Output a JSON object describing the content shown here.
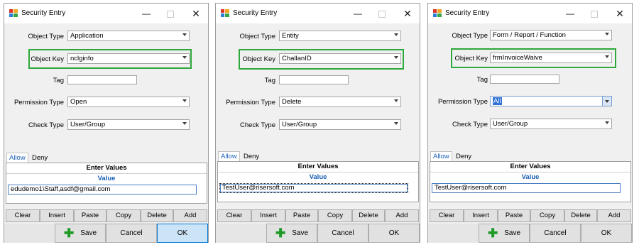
{
  "windows": [
    {
      "title": "Security Entry",
      "object_type_label": "Object Type",
      "object_type": "Application",
      "object_key_label": "Object Key",
      "object_key": "nclginfo",
      "tag_label": "Tag",
      "tag": "",
      "permission_type_label": "Permission Type",
      "permission_type": "Open",
      "check_type_label": "Check Type",
      "check_type": "User/Group",
      "tabs": [
        "Allow",
        "Deny"
      ],
      "grid_header": "Enter Values",
      "grid_column": "Value",
      "value": "edudemo1\\Staff,asdf@gmail.com",
      "grid_buttons": [
        "Clear",
        "Insert",
        "Paste",
        "Copy",
        "Delete",
        "Add"
      ],
      "save": "Save",
      "cancel": "Cancel",
      "ok": "OK"
    },
    {
      "title": "Security Entry",
      "object_type_label": "Object Type",
      "object_type": "Entity",
      "object_key_label": "Object Key",
      "object_key": "ChallanID",
      "tag_label": "Tag",
      "tag": "",
      "permission_type_label": "Permission Type",
      "permission_type": "Delete",
      "check_type_label": "Check Type",
      "check_type": "User/Group",
      "tabs": [
        "Allow",
        "Deny"
      ],
      "grid_header": "Enter Values",
      "grid_column": "Value",
      "value": "TestUser@risersoft.com",
      "grid_buttons": [
        "Clear",
        "Insert",
        "Paste",
        "Copy",
        "Delete",
        "Add"
      ],
      "save": "Save",
      "cancel": "Cancel",
      "ok": "OK"
    },
    {
      "title": "Security Entry",
      "object_type_label": "Object Type",
      "object_type": "Form / Report / Function",
      "object_key_label": "Object Key",
      "object_key": "frmInvoiceWaive",
      "tag_label": "Tag",
      "tag": "",
      "permission_type_label": "Permission Type",
      "permission_type": "All",
      "check_type_label": "Check Type",
      "check_type": "User/Group",
      "tabs": [
        "Allow",
        "Deny"
      ],
      "grid_header": "Enter Values",
      "grid_column": "Value",
      "value": "TestUser@risersoft.com",
      "grid_buttons": [
        "Clear",
        "Insert",
        "Paste",
        "Copy",
        "Delete",
        "Add"
      ],
      "save": "Save",
      "cancel": "Cancel",
      "ok": "OK"
    }
  ],
  "icons": {
    "app": "security-app-icon",
    "minimize": "minimize-icon",
    "maximize": "maximize-icon",
    "close": "close-icon",
    "dropdown": "chevron-down-icon",
    "save": "plus-icon"
  },
  "colors": {
    "highlight": "#2ea83a",
    "accent": "#1a5fb4",
    "selection": "#3172d6",
    "save_plus": "#1e9b26",
    "default_button": "#cce4f7"
  }
}
